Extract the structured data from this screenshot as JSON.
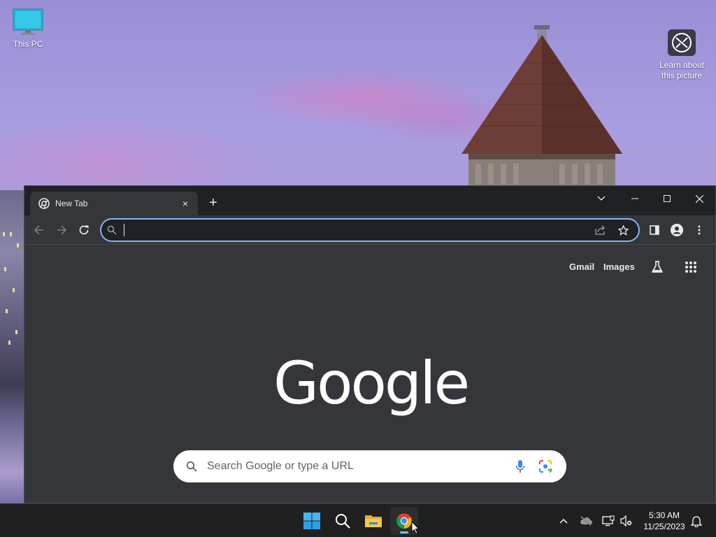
{
  "desktop": {
    "icons": [
      {
        "label": "This PC",
        "icon": "monitor-icon"
      },
      {
        "label": "Learn about\nthis picture",
        "icon": "camera-icon"
      }
    ]
  },
  "browser": {
    "tab": {
      "title": "New Tab",
      "favicon": "chrome-icon",
      "close": "×"
    },
    "new_tab": "+",
    "window_controls": [
      "tab-search",
      "minimize",
      "maximize",
      "close"
    ],
    "omnibox": {
      "value": "",
      "placeholder": ""
    },
    "ntp": {
      "links": [
        "Gmail",
        "Images"
      ],
      "logo": "Google",
      "search_placeholder": "Search Google or type a URL"
    }
  },
  "taskbar": {
    "apps": [
      "start",
      "search",
      "file-explorer",
      "chrome"
    ],
    "active_app": "chrome",
    "tray": [
      "chevron-up",
      "onedrive",
      "network",
      "volume",
      "notifications"
    ],
    "time": "5:30 AM",
    "date": "11/25/2023"
  },
  "colors": {
    "accent": "#8ab4f8",
    "browser_bg": "#35363a",
    "titlebar_bg": "#202124",
    "taskbar_bg": "#202020",
    "indicator": "#60cdff"
  }
}
